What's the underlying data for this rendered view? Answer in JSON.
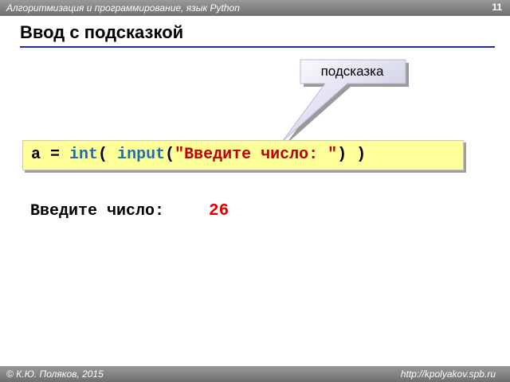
{
  "header": {
    "course": "Алгоритмизация и программирование, язык Python",
    "page_number": "11"
  },
  "slide": {
    "title": "Ввод с подсказкой"
  },
  "callout": {
    "label": "подсказка"
  },
  "code": {
    "var": "a",
    "eq": " = ",
    "func_int": "int",
    "paren_open1": "( ",
    "func_input": "input",
    "paren_open2": "(",
    "string": "\"Введите число: \"",
    "paren_close": ") )"
  },
  "output": {
    "prompt": "Введите число:",
    "user_input": "26"
  },
  "footer": {
    "copyright": "© К.Ю. Поляков, 2015",
    "site": "http://kpolyakov.spb.ru"
  },
  "colors": {
    "keyword": "#1a6fb0",
    "string": "#c00000",
    "code_bg": "#ffff99",
    "title_rule": "#1f2f8f",
    "user_input": "#e00000"
  }
}
